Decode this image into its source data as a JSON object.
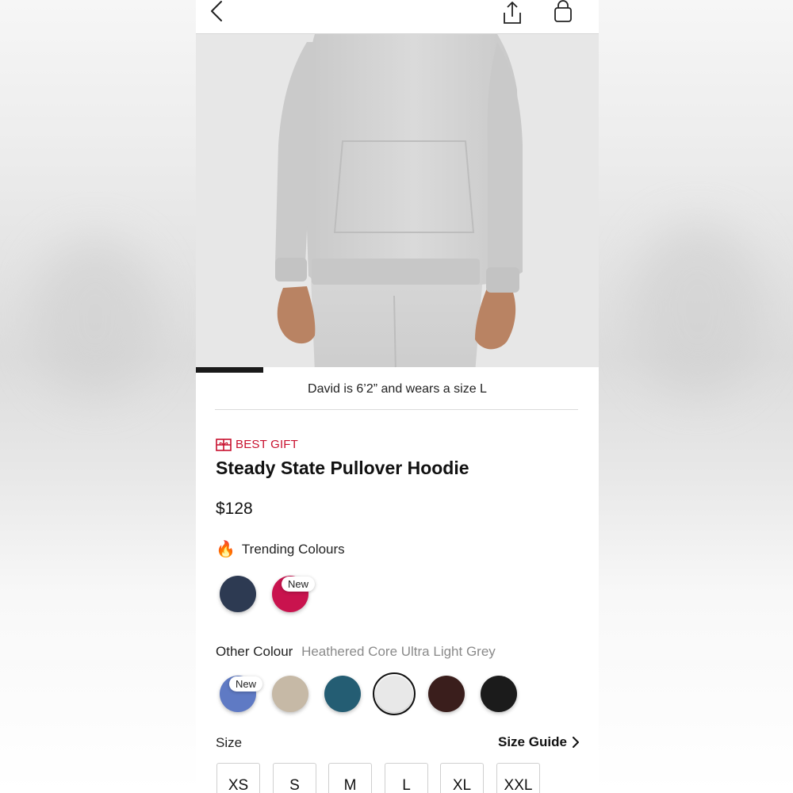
{
  "header": {
    "back_icon": "chevron-left-icon",
    "share_icon": "share-icon",
    "bag_icon": "shopping-bag-icon"
  },
  "gallery": {
    "image_description": "Model wearing light grey pullover hoodie and matching grey joggers",
    "caption": "David is 6’2” and wears a size L",
    "progress_fraction": 0.17
  },
  "product": {
    "badge_icon": "gift-icon",
    "badge": "BEST GIFT",
    "title": "Steady State Pullover Hoodie",
    "price": "$128"
  },
  "trending": {
    "icon": "fire-icon",
    "label": "Trending Colours",
    "swatches": [
      {
        "name": "navy",
        "color": "#2d3a52",
        "tag": ""
      },
      {
        "name": "magenta",
        "color": "#c9134e",
        "tag": "New"
      }
    ]
  },
  "other_colours": {
    "label": "Other Colour",
    "selected_name": "Heathered Core Ultra Light Grey",
    "swatches": [
      {
        "name": "periwinkle",
        "color": "#5f7ac4",
        "tag": "New",
        "selected": false
      },
      {
        "name": "oat",
        "color": "#c6b9a6",
        "tag": "",
        "selected": false
      },
      {
        "name": "teal",
        "color": "#245d73",
        "tag": "",
        "selected": false
      },
      {
        "name": "ultra-light-grey",
        "color": "#e8e8e8",
        "tag": "",
        "selected": true
      },
      {
        "name": "espresso",
        "color": "#3a1e1c",
        "tag": "",
        "selected": false
      },
      {
        "name": "black",
        "color": "#1b1b1b",
        "tag": "",
        "selected": false
      }
    ]
  },
  "size": {
    "label": "Size",
    "guide_label": "Size Guide",
    "guide_icon": "chevron-right-icon",
    "options": [
      "XS",
      "S",
      "M",
      "L",
      "XL",
      "XXL"
    ]
  },
  "colors": {
    "accent_red": "#c8102e",
    "text": "#111111",
    "muted": "#8a8a8a"
  }
}
